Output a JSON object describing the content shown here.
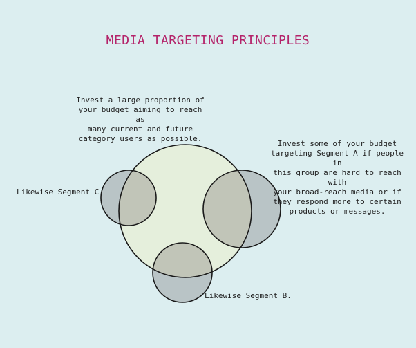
{
  "title": "MEDIA TARGETING PRINCIPLES",
  "colors": {
    "background": "#dceef0",
    "title": "#b4236a",
    "main_circle_fill": "#e5efdc",
    "segment_fill": "#b9c4c6",
    "segment_overlap_fill": "#c1c5b8",
    "outline": "#1a1a1a"
  },
  "annotations": {
    "main": "Invest a large proportion of\nyour budget aiming to reach as\nmany current and future\ncategory users as possible.",
    "segment_a": "Invest some of your budget\ntargeting Segment A if people in\nthis group are hard to reach with\nyour broad-reach media or if\nthey respond more to certain\nproducts or messages.",
    "segment_b": "Likewise Segment B.",
    "segment_c": "Likewise Segment C."
  }
}
